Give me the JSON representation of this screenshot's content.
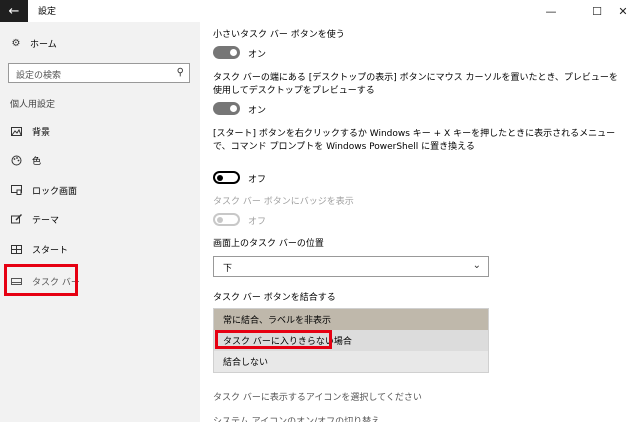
{
  "window": {
    "title": "設定",
    "back_icon": "arrow-left-icon",
    "minimize": "—",
    "maximize": "☐",
    "close": "✕"
  },
  "sidebar": {
    "home": {
      "icon": "gear-icon",
      "label": "ホーム"
    },
    "search": {
      "placeholder": "設定の検索",
      "icon": "search-icon"
    },
    "section_title": "個人用設定",
    "items": [
      {
        "icon": "picture-icon",
        "label": "背景"
      },
      {
        "icon": "palette-icon",
        "label": "色"
      },
      {
        "icon": "lock-screen-icon",
        "label": "ロック画面"
      },
      {
        "icon": "theme-brush-icon",
        "label": "テーマ"
      },
      {
        "icon": "start-grid-icon",
        "label": "スタート"
      },
      {
        "icon": "taskbar-icon",
        "label": "タスク バー"
      }
    ],
    "highlight_color": "#e60012"
  },
  "main": {
    "small_buttons": {
      "label": "小さいタスク バー ボタンを使う",
      "state": "オン"
    },
    "peek": {
      "label": "タスク バーの端にある [デスクトップの表示] ボタンにマウス カーソルを置いたとき、プレビューを使用してデスクトップをプレビューする",
      "state": "オン"
    },
    "powershell": {
      "label": "[スタート] ボタンを右クリックするか Windows キー + X キーを押したときに表示されるメニューで、コマンド プロンプトを Windows PowerShell に置き換える",
      "state": "オフ"
    },
    "badges": {
      "label": "タスク バー ボタンにバッジを表示",
      "state": "オフ"
    },
    "location": {
      "label": "画面上のタスク バーの位置",
      "value": "下"
    },
    "combine": {
      "label": "タスク バー ボタンを結合する",
      "options": [
        "常に結合、ラベルを非表示",
        "タスク バーに入りきらない場合",
        "結合しない"
      ],
      "selected_index": 0
    },
    "notify_icons": "タスク バーに表示するアイコンを選択してください",
    "system_icons": "システム アイコンのオン/オフの切り替え"
  }
}
